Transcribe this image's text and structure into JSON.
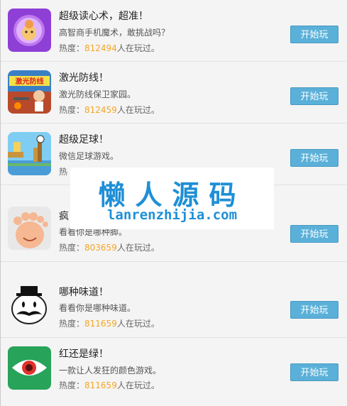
{
  "games": [
    {
      "title": "超级读心术，超准！",
      "desc": "高智商手机魔术，敢挑战吗？",
      "heat_prefix": "热度：",
      "heat_num": "812494",
      "heat_suffix": "人在玩过。",
      "button": "开始玩",
      "icon": "crystal-ball-icon"
    },
    {
      "title": "激光防线！",
      "desc": "激光防线保卫家园。",
      "heat_prefix": "热度：",
      "heat_num": "812459",
      "heat_suffix": "人在玩过。",
      "button": "开始玩",
      "icon": "laser-defense-icon",
      "icon_text": "激光防线"
    },
    {
      "title": "超级足球！",
      "desc": "微信足球游戏。",
      "heat_prefix": "热",
      "heat_num": "",
      "heat_suffix": "",
      "button": "开始玩",
      "icon": "soccer-icon"
    },
    {
      "title": "疯",
      "desc": "看看你是哪种脚。",
      "heat_prefix": "热度：",
      "heat_num": "803659",
      "heat_suffix": "人在玩过。",
      "button": "开始玩",
      "icon": "foot-icon"
    },
    {
      "title": "哪种味道！",
      "desc": "看看你是哪种味道。",
      "heat_prefix": "热度：",
      "heat_num": "811659",
      "heat_suffix": "人在玩过。",
      "button": "开始玩",
      "icon": "mustache-face-icon"
    },
    {
      "title": "红还是绿！",
      "desc": "一款让人发狂的颜色游戏。",
      "heat_prefix": "热度：",
      "heat_num": "811659",
      "heat_suffix": "人在玩过。",
      "button": "开始玩",
      "icon": "eye-icon"
    }
  ],
  "watermark": {
    "cn": "懒人源码",
    "url": "lanrenzhijia.com"
  },
  "colors": {
    "button": "#5ab0d8",
    "heat_number": "#f5a623",
    "watermark": "#1e8fd6"
  }
}
